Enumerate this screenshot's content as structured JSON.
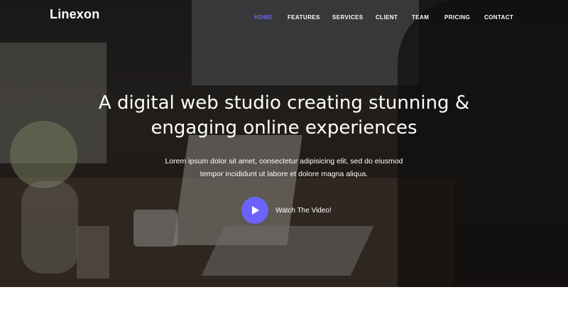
{
  "brand": {
    "name": "Linexon"
  },
  "nav": {
    "items": [
      {
        "label": "HOME",
        "active": true
      },
      {
        "label": "FEATURES",
        "active": false
      },
      {
        "label": "SERVICES",
        "active": false
      },
      {
        "label": "CLIENT",
        "active": false
      },
      {
        "label": "TEAM",
        "active": false
      },
      {
        "label": "PRICING",
        "active": false
      },
      {
        "label": "CONTACT",
        "active": false
      }
    ]
  },
  "hero": {
    "headline_line1": "A digital web studio creating stunning &",
    "headline_line2": "engaging online experiences",
    "sub_line1": "Lorem ipsum dolor sit amet, consectetur adipisicing elit, sed do eiusmod",
    "sub_line2": "tempor incididunt ut labore et dolore magna aliqua.",
    "video_label": "Watch The Video!",
    "play_icon": "play-icon"
  },
  "colors": {
    "accent": "#6c63ff",
    "text": "#ffffff"
  }
}
